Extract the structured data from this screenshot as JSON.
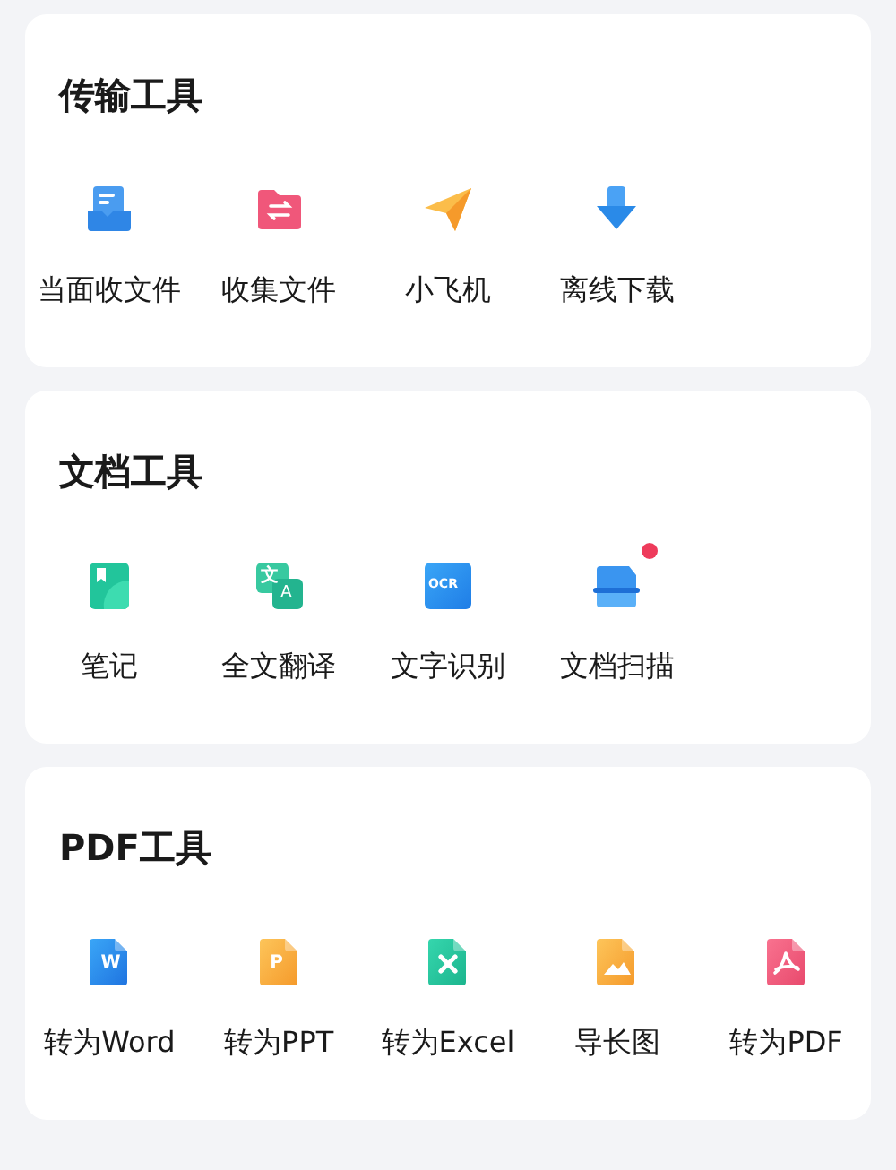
{
  "sections": [
    {
      "title": "传输工具",
      "tools": [
        {
          "label": "当面收文件",
          "kind": "doc-tray",
          "badge": false
        },
        {
          "label": "收集文件",
          "kind": "folder-swap",
          "badge": false
        },
        {
          "label": "小飞机",
          "kind": "paper-plane",
          "badge": false
        },
        {
          "label": "离线下载",
          "kind": "download",
          "badge": false
        }
      ]
    },
    {
      "title": "文档工具",
      "tools": [
        {
          "label": "笔记",
          "kind": "notebook",
          "badge": false
        },
        {
          "label": "全文翻译",
          "kind": "translate",
          "glyphs": [
            "文",
            "A"
          ],
          "badge": false
        },
        {
          "label": "文字识别",
          "kind": "ocr",
          "glyphs": [
            "OCR"
          ],
          "badge": false
        },
        {
          "label": "文档扫描",
          "kind": "scanner",
          "badge": true
        }
      ]
    },
    {
      "title": "PDF工具",
      "tools": [
        {
          "label": "转为Word",
          "kind": "word",
          "glyphs": [
            "W"
          ],
          "badge": false
        },
        {
          "label": "转为PPT",
          "kind": "ppt",
          "glyphs": [
            "P"
          ],
          "badge": false
        },
        {
          "label": "转为Excel",
          "kind": "excel",
          "badge": false
        },
        {
          "label": "导长图",
          "kind": "long-image",
          "badge": false
        },
        {
          "label": "转为PDF",
          "kind": "pdf",
          "badge": false
        }
      ]
    }
  ]
}
